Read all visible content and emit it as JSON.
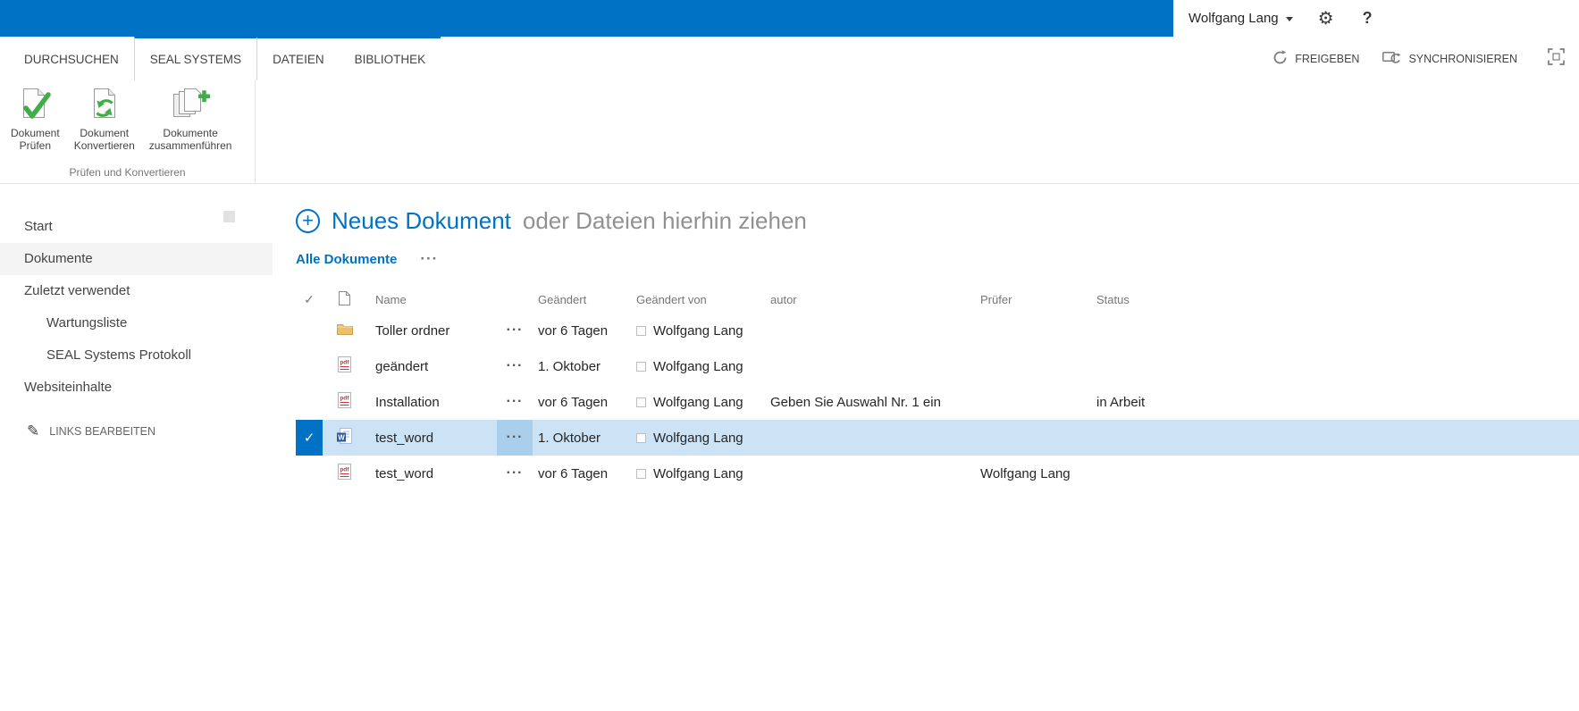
{
  "icons": {
    "gear": "⚙",
    "help": "?",
    "check": "✓",
    "plus": "+",
    "ellipsis": "···",
    "pencil": "✎"
  },
  "topbar": {
    "user_name": "Wolfgang Lang"
  },
  "ribbon": {
    "tabs": [
      {
        "label": "DURCHSUCHEN"
      },
      {
        "label": "SEAL SYSTEMS"
      },
      {
        "label": "DATEIEN"
      },
      {
        "label": "BIBLIOTHEK"
      }
    ],
    "share_label": "FREIGEBEN",
    "sync_label": "SYNCHRONISIEREN",
    "buttons": [
      {
        "line1": "Dokument",
        "line2": "Prüfen",
        "icon": "document-check-icon"
      },
      {
        "line1": "Dokument",
        "line2": "Konvertieren",
        "icon": "document-convert-icon"
      },
      {
        "line1": "Dokumente",
        "line2": "zusammenführen",
        "icon": "documents-merge-icon"
      }
    ],
    "group_label": "Prüfen und Konvertieren"
  },
  "sidebar": {
    "items": [
      {
        "label": "Start"
      },
      {
        "label": "Dokumente"
      },
      {
        "label": "Zuletzt verwendet"
      },
      {
        "label": "Wartungsliste"
      },
      {
        "label": "SEAL Systems Protokoll"
      },
      {
        "label": "Websiteinhalte"
      }
    ],
    "edit_links_label": "LINKS BEARBEITEN"
  },
  "main": {
    "new_document_label": "Neues Dokument",
    "new_document_suffix": "oder Dateien hierhin ziehen",
    "view_label": "Alle Dokumente",
    "table": {
      "headers": {
        "name": "Name",
        "modified": "Geändert",
        "modified_by": "Geändert von",
        "autor": "autor",
        "pruefer": "Prüfer",
        "status": "Status"
      },
      "rows": [
        {
          "icon": "folder-icon",
          "name": "Toller ordner",
          "modified": "vor 6 Tagen",
          "modified_by": "Wolfgang Lang",
          "autor": "",
          "pruefer": "",
          "status": "",
          "selected": false
        },
        {
          "icon": "pdf-file-icon",
          "name": "geändert",
          "modified": "1. Oktober",
          "modified_by": "Wolfgang Lang",
          "autor": "",
          "pruefer": "",
          "status": "",
          "selected": false
        },
        {
          "icon": "pdf-file-icon",
          "name": "Installation",
          "modified": "vor 6 Tagen",
          "modified_by": "Wolfgang Lang",
          "autor": "Geben Sie Auswahl Nr. 1 ein",
          "pruefer": "",
          "status": "in Arbeit",
          "selected": false
        },
        {
          "icon": "word-file-icon",
          "name": "test_word",
          "modified": "1. Oktober",
          "modified_by": "Wolfgang Lang",
          "autor": "",
          "pruefer": "",
          "status": "",
          "selected": true
        },
        {
          "icon": "pdf-file-icon",
          "name": "test_word",
          "modified": "vor 6 Tagen",
          "modified_by": "Wolfgang Lang",
          "autor": "",
          "pruefer": "Wolfgang Lang",
          "status": "",
          "selected": false
        }
      ]
    }
  },
  "colors": {
    "brand_blue": "#0072c6",
    "selected_row_bg": "#cbe3f5",
    "selected_menu_bg": "#a9cfed",
    "green_accent": "#3fae49"
  }
}
